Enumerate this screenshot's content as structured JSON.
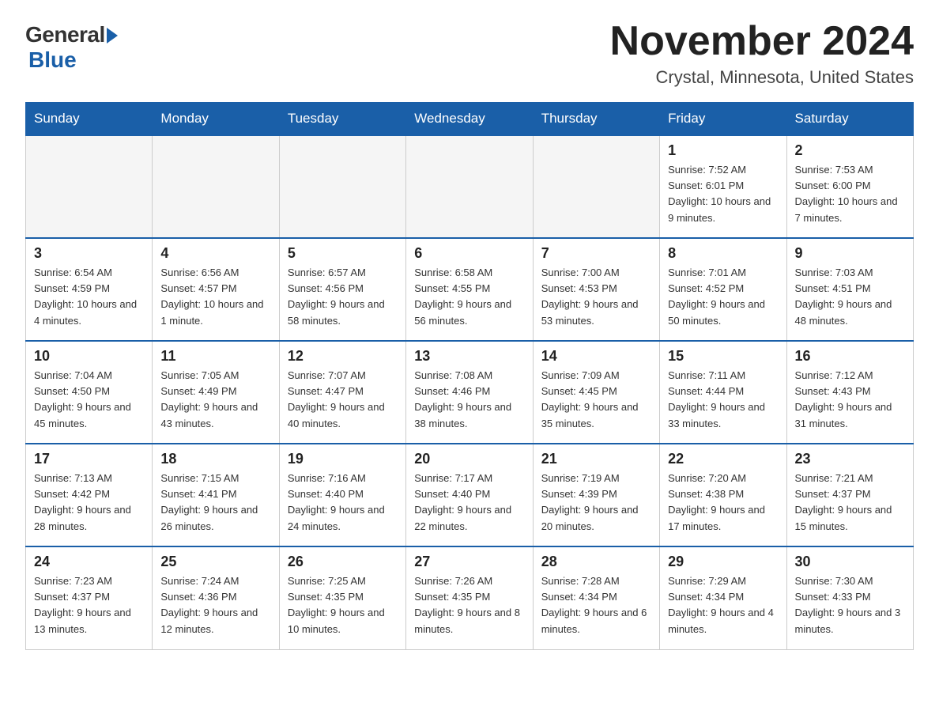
{
  "header": {
    "logo_general": "General",
    "logo_blue": "Blue",
    "month_title": "November 2024",
    "location": "Crystal, Minnesota, United States"
  },
  "weekdays": [
    "Sunday",
    "Monday",
    "Tuesday",
    "Wednesday",
    "Thursday",
    "Friday",
    "Saturday"
  ],
  "weeks": [
    [
      {
        "day": "",
        "info": ""
      },
      {
        "day": "",
        "info": ""
      },
      {
        "day": "",
        "info": ""
      },
      {
        "day": "",
        "info": ""
      },
      {
        "day": "",
        "info": ""
      },
      {
        "day": "1",
        "info": "Sunrise: 7:52 AM\nSunset: 6:01 PM\nDaylight: 10 hours and 9 minutes."
      },
      {
        "day": "2",
        "info": "Sunrise: 7:53 AM\nSunset: 6:00 PM\nDaylight: 10 hours and 7 minutes."
      }
    ],
    [
      {
        "day": "3",
        "info": "Sunrise: 6:54 AM\nSunset: 4:59 PM\nDaylight: 10 hours and 4 minutes."
      },
      {
        "day": "4",
        "info": "Sunrise: 6:56 AM\nSunset: 4:57 PM\nDaylight: 10 hours and 1 minute."
      },
      {
        "day": "5",
        "info": "Sunrise: 6:57 AM\nSunset: 4:56 PM\nDaylight: 9 hours and 58 minutes."
      },
      {
        "day": "6",
        "info": "Sunrise: 6:58 AM\nSunset: 4:55 PM\nDaylight: 9 hours and 56 minutes."
      },
      {
        "day": "7",
        "info": "Sunrise: 7:00 AM\nSunset: 4:53 PM\nDaylight: 9 hours and 53 minutes."
      },
      {
        "day": "8",
        "info": "Sunrise: 7:01 AM\nSunset: 4:52 PM\nDaylight: 9 hours and 50 minutes."
      },
      {
        "day": "9",
        "info": "Sunrise: 7:03 AM\nSunset: 4:51 PM\nDaylight: 9 hours and 48 minutes."
      }
    ],
    [
      {
        "day": "10",
        "info": "Sunrise: 7:04 AM\nSunset: 4:50 PM\nDaylight: 9 hours and 45 minutes."
      },
      {
        "day": "11",
        "info": "Sunrise: 7:05 AM\nSunset: 4:49 PM\nDaylight: 9 hours and 43 minutes."
      },
      {
        "day": "12",
        "info": "Sunrise: 7:07 AM\nSunset: 4:47 PM\nDaylight: 9 hours and 40 minutes."
      },
      {
        "day": "13",
        "info": "Sunrise: 7:08 AM\nSunset: 4:46 PM\nDaylight: 9 hours and 38 minutes."
      },
      {
        "day": "14",
        "info": "Sunrise: 7:09 AM\nSunset: 4:45 PM\nDaylight: 9 hours and 35 minutes."
      },
      {
        "day": "15",
        "info": "Sunrise: 7:11 AM\nSunset: 4:44 PM\nDaylight: 9 hours and 33 minutes."
      },
      {
        "day": "16",
        "info": "Sunrise: 7:12 AM\nSunset: 4:43 PM\nDaylight: 9 hours and 31 minutes."
      }
    ],
    [
      {
        "day": "17",
        "info": "Sunrise: 7:13 AM\nSunset: 4:42 PM\nDaylight: 9 hours and 28 minutes."
      },
      {
        "day": "18",
        "info": "Sunrise: 7:15 AM\nSunset: 4:41 PM\nDaylight: 9 hours and 26 minutes."
      },
      {
        "day": "19",
        "info": "Sunrise: 7:16 AM\nSunset: 4:40 PM\nDaylight: 9 hours and 24 minutes."
      },
      {
        "day": "20",
        "info": "Sunrise: 7:17 AM\nSunset: 4:40 PM\nDaylight: 9 hours and 22 minutes."
      },
      {
        "day": "21",
        "info": "Sunrise: 7:19 AM\nSunset: 4:39 PM\nDaylight: 9 hours and 20 minutes."
      },
      {
        "day": "22",
        "info": "Sunrise: 7:20 AM\nSunset: 4:38 PM\nDaylight: 9 hours and 17 minutes."
      },
      {
        "day": "23",
        "info": "Sunrise: 7:21 AM\nSunset: 4:37 PM\nDaylight: 9 hours and 15 minutes."
      }
    ],
    [
      {
        "day": "24",
        "info": "Sunrise: 7:23 AM\nSunset: 4:37 PM\nDaylight: 9 hours and 13 minutes."
      },
      {
        "day": "25",
        "info": "Sunrise: 7:24 AM\nSunset: 4:36 PM\nDaylight: 9 hours and 12 minutes."
      },
      {
        "day": "26",
        "info": "Sunrise: 7:25 AM\nSunset: 4:35 PM\nDaylight: 9 hours and 10 minutes."
      },
      {
        "day": "27",
        "info": "Sunrise: 7:26 AM\nSunset: 4:35 PM\nDaylight: 9 hours and 8 minutes."
      },
      {
        "day": "28",
        "info": "Sunrise: 7:28 AM\nSunset: 4:34 PM\nDaylight: 9 hours and 6 minutes."
      },
      {
        "day": "29",
        "info": "Sunrise: 7:29 AM\nSunset: 4:34 PM\nDaylight: 9 hours and 4 minutes."
      },
      {
        "day": "30",
        "info": "Sunrise: 7:30 AM\nSunset: 4:33 PM\nDaylight: 9 hours and 3 minutes."
      }
    ]
  ]
}
